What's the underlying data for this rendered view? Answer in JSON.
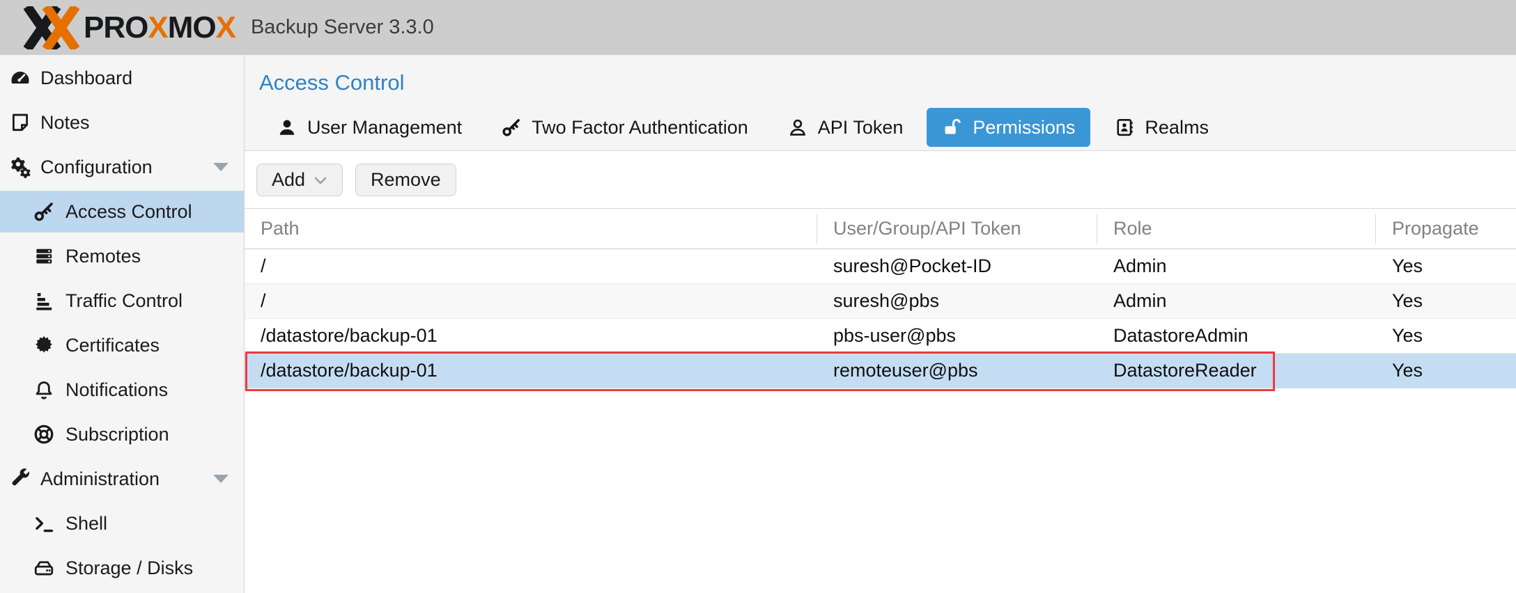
{
  "brand": {
    "word_dark_1": "PRO",
    "word_orange_1": "X",
    "word_dark_2": "MO",
    "word_orange_2": "X",
    "product_title": "Backup Server 3.3.0"
  },
  "sidebar": {
    "items": [
      {
        "label": "Dashboard",
        "icon": "dashboard-icon",
        "level": 1,
        "selected": false
      },
      {
        "label": "Notes",
        "icon": "note-icon",
        "level": 1,
        "selected": false
      },
      {
        "label": "Configuration",
        "icon": "gears-icon",
        "level": 1,
        "selected": false,
        "expandable": true
      },
      {
        "label": "Access Control",
        "icon": "key-icon",
        "level": 2,
        "selected": true
      },
      {
        "label": "Remotes",
        "icon": "servers-icon",
        "level": 2,
        "selected": false
      },
      {
        "label": "Traffic Control",
        "icon": "traffic-bars-icon",
        "level": 2,
        "selected": false
      },
      {
        "label": "Certificates",
        "icon": "certificate-icon",
        "level": 2,
        "selected": false
      },
      {
        "label": "Notifications",
        "icon": "bell-icon",
        "level": 2,
        "selected": false
      },
      {
        "label": "Subscription",
        "icon": "life-ring-icon",
        "level": 2,
        "selected": false
      },
      {
        "label": "Administration",
        "icon": "wrench-icon",
        "level": 1,
        "selected": false,
        "expandable": true
      },
      {
        "label": "Shell",
        "icon": "terminal-icon",
        "level": 2,
        "selected": false
      },
      {
        "label": "Storage / Disks",
        "icon": "hdd-icon",
        "level": 2,
        "selected": false
      }
    ]
  },
  "page": {
    "title": "Access Control"
  },
  "tabs": [
    {
      "label": "User Management",
      "icon": "user-icon",
      "selected": false
    },
    {
      "label": "Two Factor Authentication",
      "icon": "key-icon",
      "selected": false
    },
    {
      "label": "API Token",
      "icon": "user-outline-icon",
      "selected": false
    },
    {
      "label": "Permissions",
      "icon": "unlock-icon",
      "selected": true
    },
    {
      "label": "Realms",
      "icon": "address-book-icon",
      "selected": false
    }
  ],
  "toolbar": {
    "add_label": "Add",
    "remove_label": "Remove"
  },
  "table": {
    "columns": [
      "Path",
      "User/Group/API Token",
      "Role",
      "Propagate"
    ],
    "rows": [
      {
        "path": "/",
        "user": "suresh@Pocket-ID",
        "role": "Admin",
        "propagate": "Yes",
        "selected": false
      },
      {
        "path": "/",
        "user": "suresh@pbs",
        "role": "Admin",
        "propagate": "Yes",
        "selected": false
      },
      {
        "path": "/datastore/backup-01",
        "user": "pbs-user@pbs",
        "role": "DatastoreAdmin",
        "propagate": "Yes",
        "selected": false
      },
      {
        "path": "/datastore/backup-01",
        "user": "remoteuser@pbs",
        "role": "DatastoreReader",
        "propagate": "Yes",
        "selected": true
      }
    ]
  },
  "colors": {
    "brand_orange": "#e57000",
    "header_bg": "#cdcdcd",
    "sidebar_bg": "#f5f5f5",
    "sidebar_selected_bg": "#bdd7ef",
    "accent_blue": "#3b96d5",
    "title_blue": "#2e82c8",
    "selected_row_bg": "#c5ddf2",
    "annotation_red": "#ef3a3e"
  }
}
